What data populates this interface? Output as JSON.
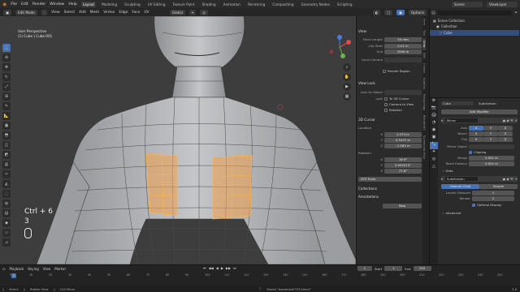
{
  "menubar": {
    "items": [
      "File",
      "Edit",
      "Render",
      "Window",
      "Help"
    ],
    "workspaces": [
      "Layout",
      "Modeling",
      "Sculpting",
      "UV Editing",
      "Texture Paint",
      "Shading",
      "Animation",
      "Rendering",
      "Compositing",
      "Geometry Nodes",
      "Scripting"
    ],
    "active_workspace": "Layout",
    "scene_label": "Scene",
    "viewlayer_label": "ViewLayer"
  },
  "header": {
    "mode": "Edit Mode",
    "menus": [
      "View",
      "Select",
      "Add",
      "Mesh",
      "Vertex",
      "Edge",
      "Face",
      "UV"
    ],
    "transform": "Global",
    "options": "Options"
  },
  "viewport": {
    "view_name": "User Perspective",
    "object_name": "(1) Cube | Cube.001",
    "key_hint": "Ctrl + 6",
    "key_hint_sub": "3"
  },
  "npanel": {
    "tabs": [
      "Item",
      "Tool",
      "View",
      "Edit",
      "Create",
      "AddOns",
      "Retopology",
      "BlenderKit",
      "Screencast Keys"
    ],
    "view_section": "View",
    "focal_length_label": "Focal Length",
    "focal_length": "50 mm",
    "clip_start_label": "Clip Start",
    "clip_start": "0.01 m",
    "clip_end_label": "End",
    "clip_end": "1000 m",
    "local_camera_label": "Local Camera",
    "render_region_label": "Render Region",
    "view_lock_section": "View Lock",
    "lock_to_object_label": "Lock to Object",
    "lock_label": "Lock",
    "to_3d_cursor": "To 3D Cursor",
    "camera_to_view": "Camera to View",
    "rotation_label": "Rotation",
    "cursor_section": "3D Cursor",
    "location_label": "Location",
    "loc_x": "2.274 m",
    "loc_y": "0.5437 m",
    "loc_z": "-1.563 m",
    "rotation_section": "Rotation",
    "rot_x": "16.9°",
    "rot_y": "0.000215°",
    "rot_z": "27.6°",
    "rotation_mode": "XYZ Euler",
    "collections_section": "Collections",
    "annotations_section": "Annotations",
    "new_label": "New"
  },
  "outliner": {
    "search_placeholder": "",
    "items": [
      "Scene Collection",
      "Collection",
      "Cube"
    ]
  },
  "properties": {
    "object_name": "Cube",
    "modifier_name": "Subdivision",
    "add_modifier": "Add Modifier",
    "mirror_name": "Mirror",
    "axis_label": "Axis",
    "bisect_label": "Bisect",
    "flip_label": "Flip",
    "axes": [
      "X",
      "Y",
      "Z"
    ],
    "mirror_object_label": "Mirror Object",
    "clipping_label": "Clipping",
    "merge_label": "Merge",
    "merge_value": "0.001 m",
    "bisect_distance_label": "Bisect Distance",
    "bisect_distance": "0.001 m",
    "data_label": "Data",
    "subsurf_name": "Subdivision",
    "catmull_label": "Catmull-Clark",
    "simple_label": "Simple",
    "levels_viewport_label": "Levels Viewport",
    "levels_viewport": "1",
    "render_label": "Render",
    "render_value": "2",
    "optimal_display_label": "Optimal Display",
    "advanced_label": "Advanced"
  },
  "timeline": {
    "menus": [
      "Playback",
      "Keying",
      "View",
      "Marker"
    ],
    "current_frame": "1",
    "ticks": [
      "0",
      "10",
      "20",
      "30",
      "40",
      "50",
      "60",
      "70",
      "80",
      "90",
      "100",
      "110",
      "120",
      "130",
      "140",
      "150",
      "160",
      "170",
      "180",
      "190",
      "200",
      "210",
      "220",
      "230",
      "240",
      "250"
    ],
    "start_label": "Start",
    "start": "1",
    "end_label": "End",
    "end": "250"
  },
  "statusbar": {
    "items": [
      "Select",
      "Rotate View",
      "Call Menu"
    ],
    "saved_message": "Saved \"basemesh70T.blend\"",
    "version": "3.6"
  },
  "colors": {
    "accent": "#4772b3",
    "selection": "#f2a04a",
    "viewport_bg": "#3d3d3d",
    "mesh": "#a9abae"
  }
}
